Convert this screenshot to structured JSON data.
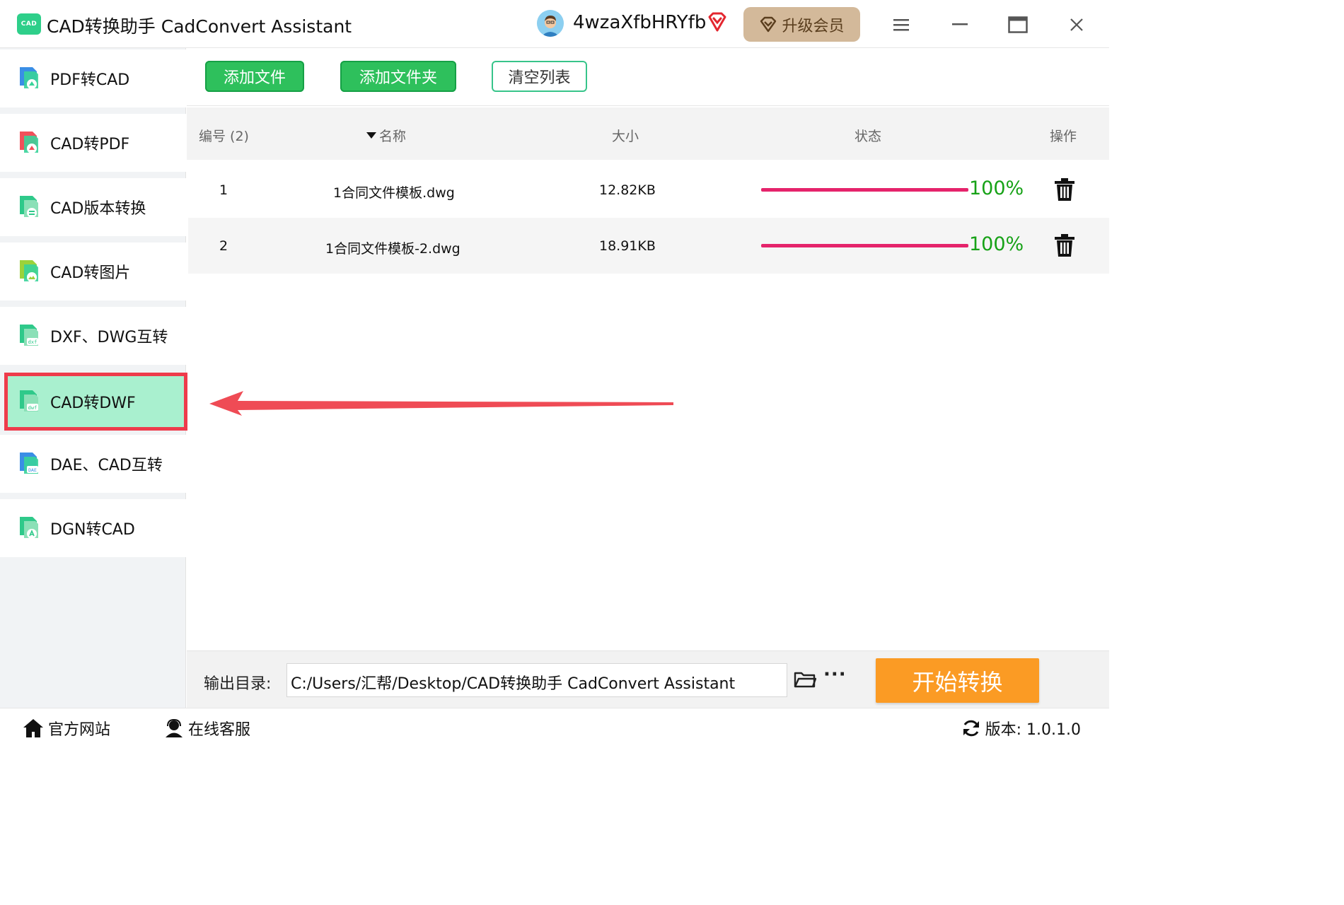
{
  "titlebar": {
    "logo_text": "CAD",
    "title": "CAD转换助手 CadConvert Assistant",
    "username": "4wzaXfbHRYfb",
    "upgrade_label": "升级会员"
  },
  "sidebar": {
    "items": [
      {
        "label": "PDF转CAD",
        "icon": "pdf-to-cad-icon"
      },
      {
        "label": "CAD转PDF",
        "icon": "cad-to-pdf-icon"
      },
      {
        "label": "CAD版本转换",
        "icon": "cad-version-icon"
      },
      {
        "label": "CAD转图片",
        "icon": "cad-to-image-icon"
      },
      {
        "label": "DXF、DWG互转",
        "icon": "dxf-dwg-icon",
        "badge": "dxf"
      },
      {
        "label": "CAD转DWF",
        "icon": "cad-to-dwf-icon",
        "badge": "dwf",
        "active": true
      },
      {
        "label": "DAE、CAD互转",
        "icon": "dae-cad-icon",
        "badge": "DAE"
      },
      {
        "label": "DGN转CAD",
        "icon": "dgn-to-cad-icon"
      }
    ]
  },
  "toolbar": {
    "add_file": "添加文件",
    "add_folder": "添加文件夹",
    "clear_list": "清空列表"
  },
  "table": {
    "headers": {
      "index": "编号 (2)",
      "name": "名称",
      "size": "大小",
      "status": "状态",
      "action": "操作"
    },
    "rows": [
      {
        "index": "1",
        "name": "1合同文件模板.dwg",
        "size": "12.82KB",
        "progress_pct": 100,
        "progress_label": "100%"
      },
      {
        "index": "2",
        "name": "1合同文件模板-2.dwg",
        "size": "18.91KB",
        "progress_pct": 100,
        "progress_label": "100%"
      }
    ]
  },
  "output": {
    "label": "输出目录:",
    "path": "C:/Users/汇帮/Desktop/CAD转换助手 CadConvert Assistant",
    "more": "···",
    "start_label": "开始转换"
  },
  "footer": {
    "website": "官方网站",
    "support": "在线客服",
    "version": "版本:  1.0.1.0"
  },
  "colors": {
    "accent_green": "#2ec05c",
    "active_item_bg": "#a9f0cf",
    "highlight_red": "#ee3b4b",
    "progress_bar": "#e5236b",
    "progress_text": "#17a217",
    "start_button": "#fb9b24",
    "upgrade_button": "#d3b99a"
  }
}
